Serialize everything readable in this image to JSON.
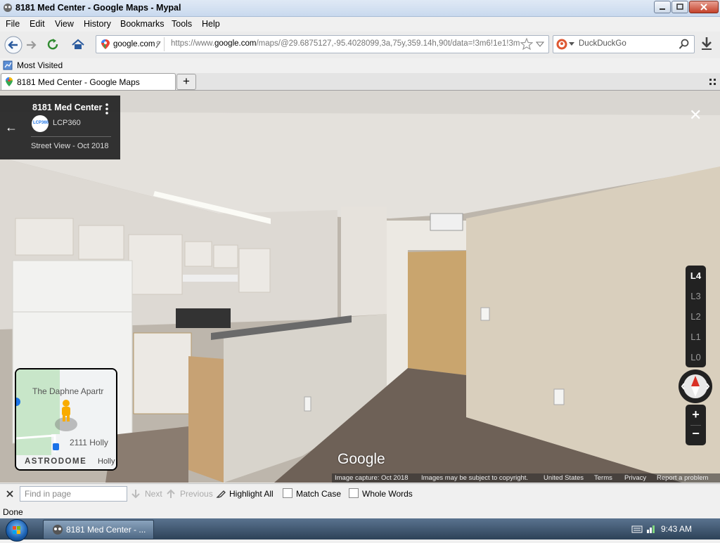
{
  "window": {
    "title": "8181 Med Center - Google Maps - Mypal"
  },
  "menu": [
    {
      "label": "File"
    },
    {
      "label": "Edit"
    },
    {
      "label": "View"
    },
    {
      "label": "History"
    },
    {
      "label": "Bookmarks"
    },
    {
      "label": "Tools"
    },
    {
      "label": "Help"
    }
  ],
  "urlbar": {
    "identity": "google.com",
    "url_prefix": "https://www.",
    "url_domain": "google.com",
    "url_rest": "/maps/@29.6875127,-95.4028099,3a,75y,359.14h,90t/data=!3m6!1e1!3m"
  },
  "search": {
    "engine": "DuckDuckGo"
  },
  "bookmarks": {
    "most_visited": "Most Visited"
  },
  "tabs": [
    {
      "label": "8181 Med Center - Google Maps"
    }
  ],
  "streetview": {
    "place": "8181 Med Center",
    "owner": "LCP360",
    "owner_logo_text": "LCP360",
    "date": "Street View - Oct 2018",
    "levels": [
      "L4",
      "L3",
      "L2",
      "L1",
      "L0"
    ],
    "active_level": "L4",
    "zoom_in": "+",
    "zoom_out": "−",
    "watermark": "Google",
    "minimap": {
      "label1": "The Daphne Apartr",
      "label2": "2111 Holly",
      "label3": "ASTRODOME",
      "label4": "Holly"
    },
    "attribution": {
      "capture": "Image capture: Oct 2018",
      "copyright": "Images may be subject to copyright.",
      "country": "United States",
      "terms": "Terms",
      "privacy": "Privacy",
      "report": "Report a problem"
    }
  },
  "findbar": {
    "placeholder": "Find in page",
    "next": "Next",
    "previous": "Previous",
    "highlight": "Highlight All",
    "match_case": "Match Case",
    "whole_words": "Whole Words"
  },
  "status": {
    "text": "Done"
  },
  "taskbar": {
    "item": "8181 Med Center - ...",
    "time": "9:43 AM"
  }
}
